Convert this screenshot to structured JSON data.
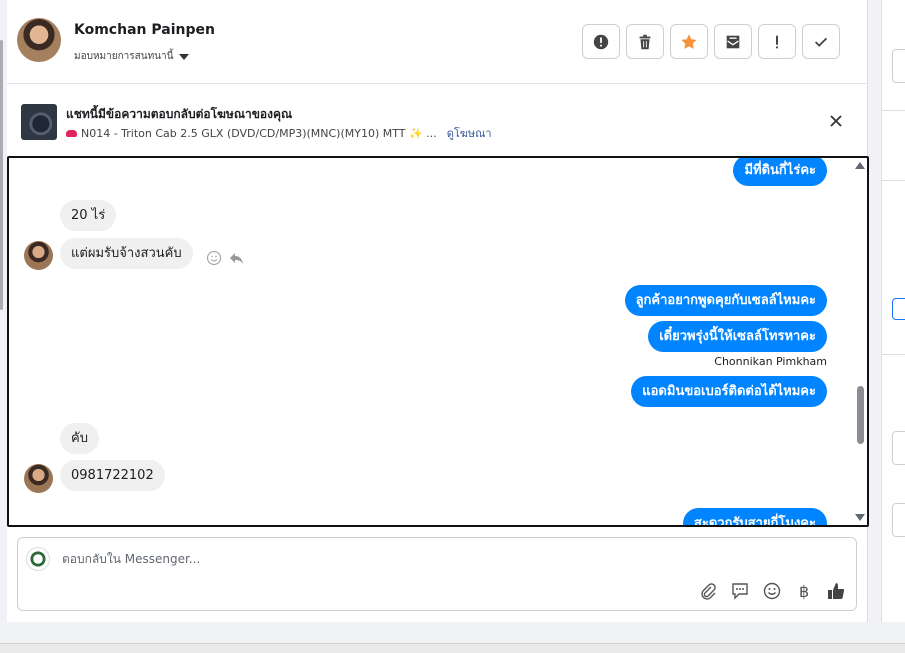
{
  "header": {
    "contact_name": "Komchan Painpen",
    "assign_label": "มอบหมายการสนทนานี้",
    "actions": [
      {
        "icon": "alert-circle-icon"
      },
      {
        "icon": "trash-icon"
      },
      {
        "icon": "star-icon",
        "color": "#f7923b"
      },
      {
        "icon": "mark-unread-icon"
      },
      {
        "icon": "exclamation-icon"
      },
      {
        "icon": "check-icon"
      }
    ]
  },
  "ad_banner": {
    "title": "แชทนี้มีข้อความตอบกลับต่อโฆษณาของคุณ",
    "subtitle": "N014 - Triton Cab 2.5 GLX (DVD/CD/MP3)(MNC)(MY10) MTT ✨ ...",
    "link": "ดูโฆษณา"
  },
  "messages": [
    {
      "side": "out",
      "text": "มีที่ดินกี่ไร่คะ"
    },
    {
      "side": "in",
      "text": "20 ไร่"
    },
    {
      "side": "in",
      "text": "แต่ผมรับจ้างสวนคับ"
    },
    {
      "side": "out",
      "text": "ลูกค้าอยากพูดคุยกับเซลล์ไหมคะ"
    },
    {
      "side": "out",
      "text": "เดี๋ยวพรุ่งนี้ให้เซลล์โทรหาคะ"
    },
    {
      "side": "out-sender",
      "text": "Chonnikan Pimkham"
    },
    {
      "side": "out",
      "text": "แอดมินขอเบอร์ติดต่อได้ไหมคะ"
    },
    {
      "side": "in",
      "text": "คับ"
    },
    {
      "side": "in",
      "text": "0981722102"
    },
    {
      "side": "out",
      "text": "สะดวกรับสายกี่โมงคะ"
    }
  ],
  "composer": {
    "placeholder": "ตอบกลับใน Messenger...",
    "tools": [
      "paperclip-icon",
      "quick-reply-icon",
      "emoji-icon",
      "baht-icon",
      "thumbs-up-icon"
    ]
  },
  "right_panel": {
    "accent": "#1877f2"
  },
  "colors": {
    "outgoing_bubble": "#0084ff",
    "incoming_bubble": "#f0f0f0"
  }
}
